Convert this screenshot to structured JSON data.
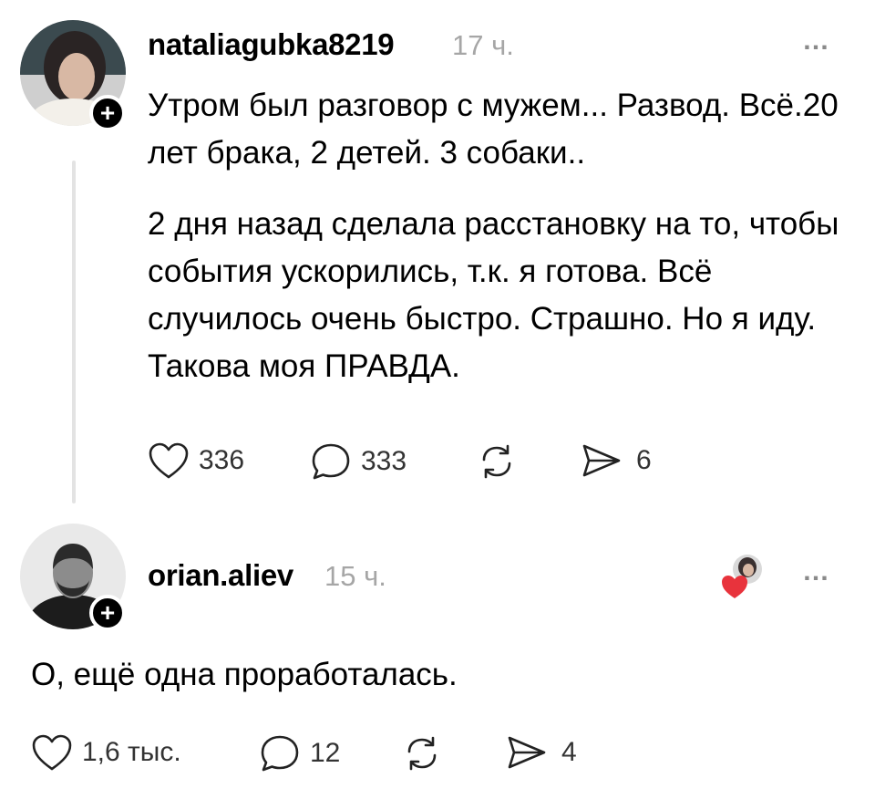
{
  "post": {
    "username": "nataliagubka8219",
    "time": "17 ч.",
    "more_icon": "…",
    "follow_icon": "+",
    "paragraph1": "Утром был разговор с мужем... Развод. Всё.20 лет брака, 2 детей. 3 собаки..",
    "paragraph2": "2 дня назад сделала расстановку на то, чтобы события ускорились, т.к. я готова. Всё случилось очень быстро. Страшно. Но я иду. Такова моя ПРАВДА.",
    "likes": "336",
    "comments": "333",
    "shares": "6"
  },
  "reply": {
    "username": "orian.aliev",
    "time": "15 ч.",
    "more_icon": "…",
    "follow_icon": "+",
    "text": "О, ещё одна проработалась.",
    "likes": "1,6 тыс.",
    "comments": "12",
    "shares": "4"
  },
  "colors": {
    "text": "#000000",
    "muted": "#a6a6a6",
    "heart": "#e8333c",
    "thread_line": "#e3e3e3"
  }
}
